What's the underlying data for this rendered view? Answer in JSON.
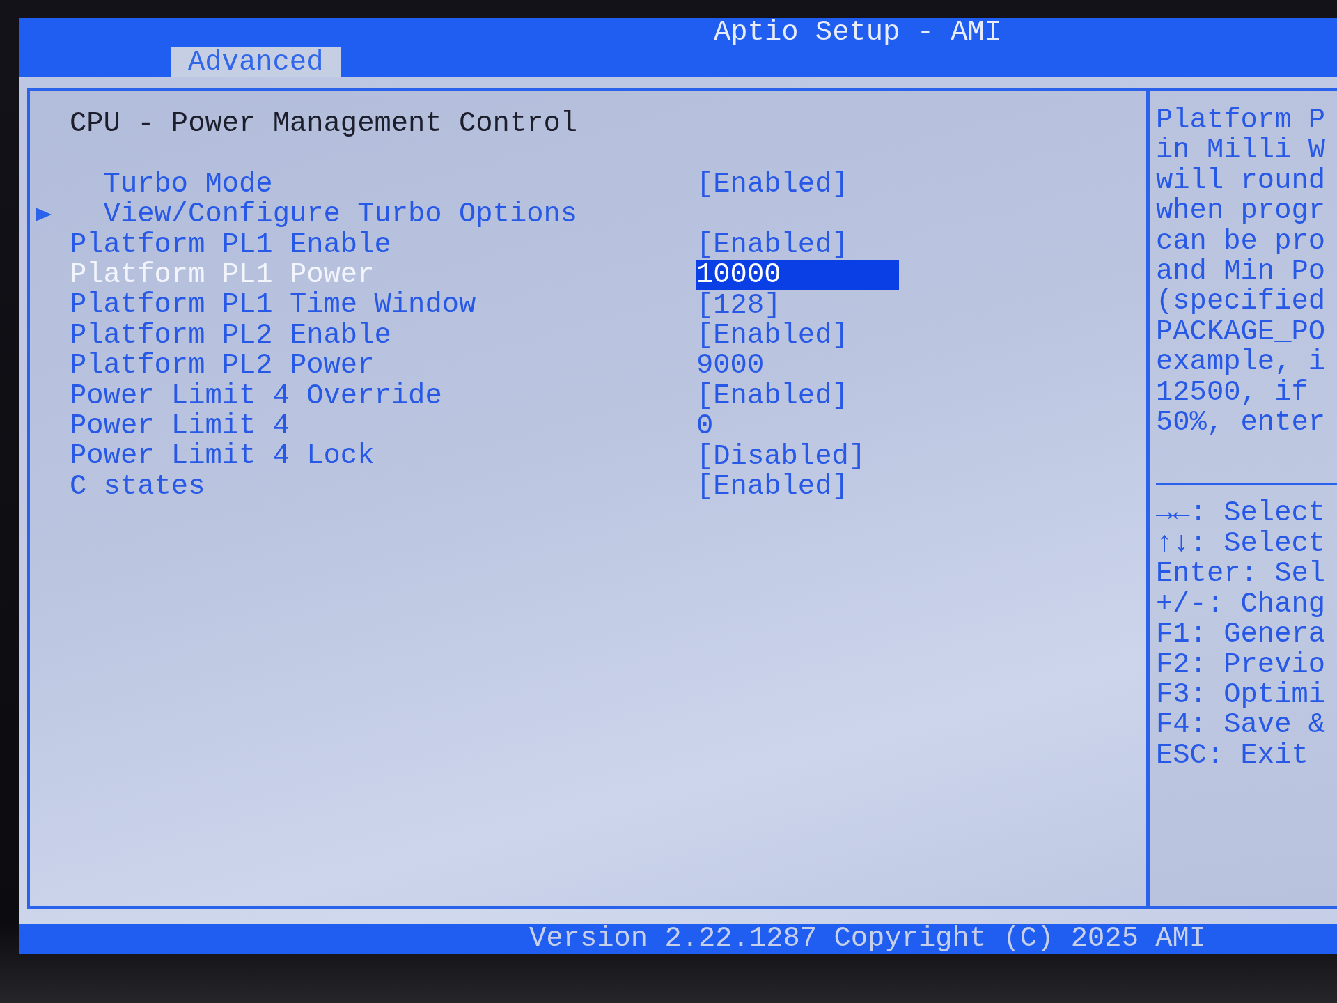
{
  "window": {
    "title": "Aptio Setup - AMI"
  },
  "tabs": [
    {
      "label": "Advanced",
      "selected": true
    }
  ],
  "page": {
    "heading": "CPU - Power Management Control",
    "settings": [
      {
        "label": "Turbo Mode",
        "value": "[Enabled]",
        "indented": true,
        "submenu": false,
        "selected": false
      },
      {
        "label": "View/Configure Turbo Options",
        "indented": true,
        "submenu": true,
        "selected": false
      },
      {
        "label": "Platform PL1 Enable",
        "value": "[Enabled]",
        "indented": false,
        "submenu": false,
        "selected": false
      },
      {
        "label": "Platform PL1 Power",
        "value": "10000",
        "indented": false,
        "submenu": false,
        "selected": true
      },
      {
        "label": "Platform PL1 Time Window",
        "value": "[128]",
        "indented": false,
        "submenu": false,
        "selected": false
      },
      {
        "label": "Platform PL2 Enable",
        "value": "[Enabled]",
        "indented": false,
        "submenu": false,
        "selected": false
      },
      {
        "label": "Platform PL2 Power",
        "value": "9000",
        "indented": false,
        "submenu": false,
        "selected": false
      },
      {
        "label": "Power Limit 4 Override",
        "value": "[Enabled]",
        "indented": false,
        "submenu": false,
        "selected": false
      },
      {
        "label": "Power Limit 4",
        "value": "0",
        "indented": false,
        "submenu": false,
        "selected": false
      },
      {
        "label": "Power Limit 4 Lock",
        "value": "[Disabled]",
        "indented": false,
        "submenu": false,
        "selected": false
      },
      {
        "label": "C states",
        "value": "[Enabled]",
        "indented": false,
        "submenu": false,
        "selected": false
      }
    ]
  },
  "help": {
    "lines": [
      "Platform P",
      "in Milli W",
      "will round",
      "when progr",
      "can be pro",
      "and Min Po",
      "(specified",
      "PACKAGE_PO",
      "example, i",
      "12500, if",
      "50%, enter"
    ]
  },
  "key_hints": [
    "→←: Select",
    "↑↓: Select",
    "Enter: Sel",
    "+/-: Chang",
    "F1: Genera",
    "F2: Previo",
    "F3: Optimi",
    "F4: Save &",
    "ESC: Exit"
  ],
  "status_bar": {
    "text": "Version 2.22.1287 Copyright (C) 2025 AMI"
  }
}
